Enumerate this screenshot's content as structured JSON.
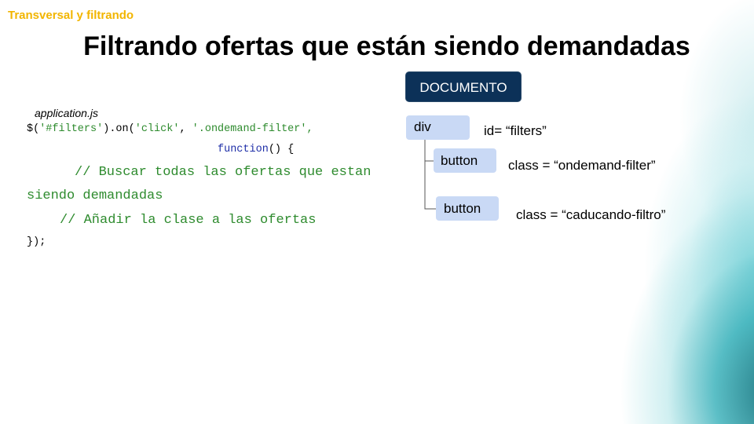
{
  "header": {
    "brand": "Transversal y filtrando",
    "title": "Filtrando ofertas que están siendo demandadas"
  },
  "code": {
    "filename": "application.js",
    "line1_a": "$(",
    "line1_b": "'#filters'",
    "line1_c": ").on(",
    "line1_d": "'click'",
    "line1_e": ", ",
    "line1_f": "'.ondemand-filter'",
    "line1_g": ",",
    "line2_kw": "function",
    "line2_rest": "() {",
    "line3": "// Buscar todas las ofertas que estan",
    "line4": "siendo demandadas",
    "line5": "// Añadir la clase a las ofertas",
    "line6": "});"
  },
  "tree": {
    "root": "DOCUMENTO",
    "div_label": "div",
    "div_attr": "id= “filters”",
    "button1_label": "button",
    "button1_attr": "class = “ondemand-filter”",
    "button2_label": "button",
    "button2_attr": "class = “caducando-filtro”"
  },
  "colors": {
    "brand": "#f2b500",
    "root_box": "#0c3158",
    "node_box": "#c9d9f5",
    "comment": "#2e8b2e",
    "keyword": "#1f2fa8"
  }
}
